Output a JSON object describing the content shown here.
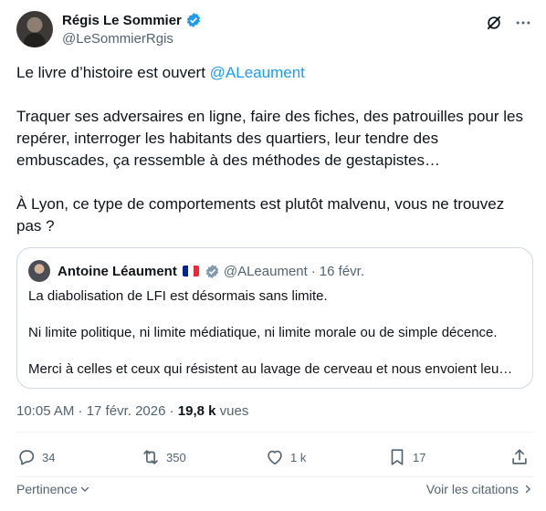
{
  "tweet": {
    "author_name": "Régis Le Sommier",
    "handle": "@LeSommierRgis",
    "text_line1_prefix": "Le livre d’histoire est ouvert",
    "text_line1_mention": "@ALeaument",
    "text_para2": "Traquer ses adversaires en ligne, faire des fiches, des patrouilles pour les repérer, interroger les habitants des quartiers, leur tendre des embuscades, ça ressemble à des méthodes de gestapistes…",
    "text_para3": "À Lyon, ce type de comportements est plutôt malvenu, vous ne trouvez pas ?",
    "timestamp": "10:05 AM · 17 févr. 2026 · ",
    "views_count": "19,8 k",
    "views_label": " vues"
  },
  "quote": {
    "author_name": "Antoine Léaument",
    "handle": "@ALeaument",
    "separator": "·",
    "date": "16 févr.",
    "line1": "La diabolisation de LFI est désormais sans limite.",
    "line2": "Ni limite politique, ni limite médiatique, ni limite morale ou de simple décence.",
    "line3": "Merci à celles et ceux qui résistent au lavage de cerveau et nous envoient leu…"
  },
  "actions": {
    "replies": "34",
    "reposts": "350",
    "likes": "1 k",
    "bookmarks": "17"
  },
  "footer": {
    "sort_label": "Pertinence",
    "citations_label": "Voir les citations"
  },
  "colors": {
    "accent": "#1d9bf0",
    "secondary_text": "#536471",
    "verified_gray": "#829aab"
  },
  "icons": [
    "verified-badge-icon",
    "grok-icon",
    "more-icon",
    "reply-icon",
    "repost-icon",
    "like-icon",
    "bookmark-icon",
    "share-icon",
    "chevron-down-icon",
    "chevron-right-icon",
    "flag-france-icon"
  ]
}
